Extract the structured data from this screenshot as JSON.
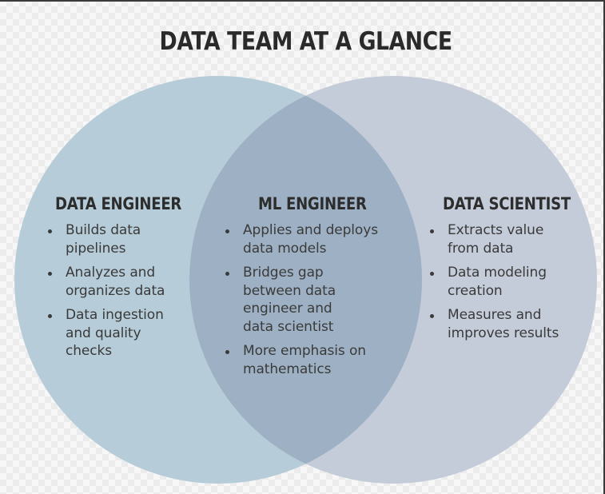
{
  "title": "DATA TEAM AT A GLANCE",
  "colors": {
    "left_circle": "#b6ccd8",
    "right_circle": "#c4ccd9",
    "overlap": "#9eb1c4",
    "text": "#333333"
  },
  "columns": [
    {
      "heading": "DATA ENGINEER",
      "items": [
        "Builds data\npipelines",
        "Analyzes and\norganizes data",
        "Data ingestion\nand quality\nchecks"
      ]
    },
    {
      "heading": "ML ENGINEER",
      "items": [
        "Applies and deploys\ndata models",
        "Bridges gap\nbetween data\nengineer and\ndata scientist",
        "More emphasis on\nmathematics"
      ]
    },
    {
      "heading": "DATA SCIENTIST",
      "items": [
        "Extracts value\nfrom data",
        "Data modeling\ncreation",
        "Measures and\nimproves results"
      ]
    }
  ]
}
